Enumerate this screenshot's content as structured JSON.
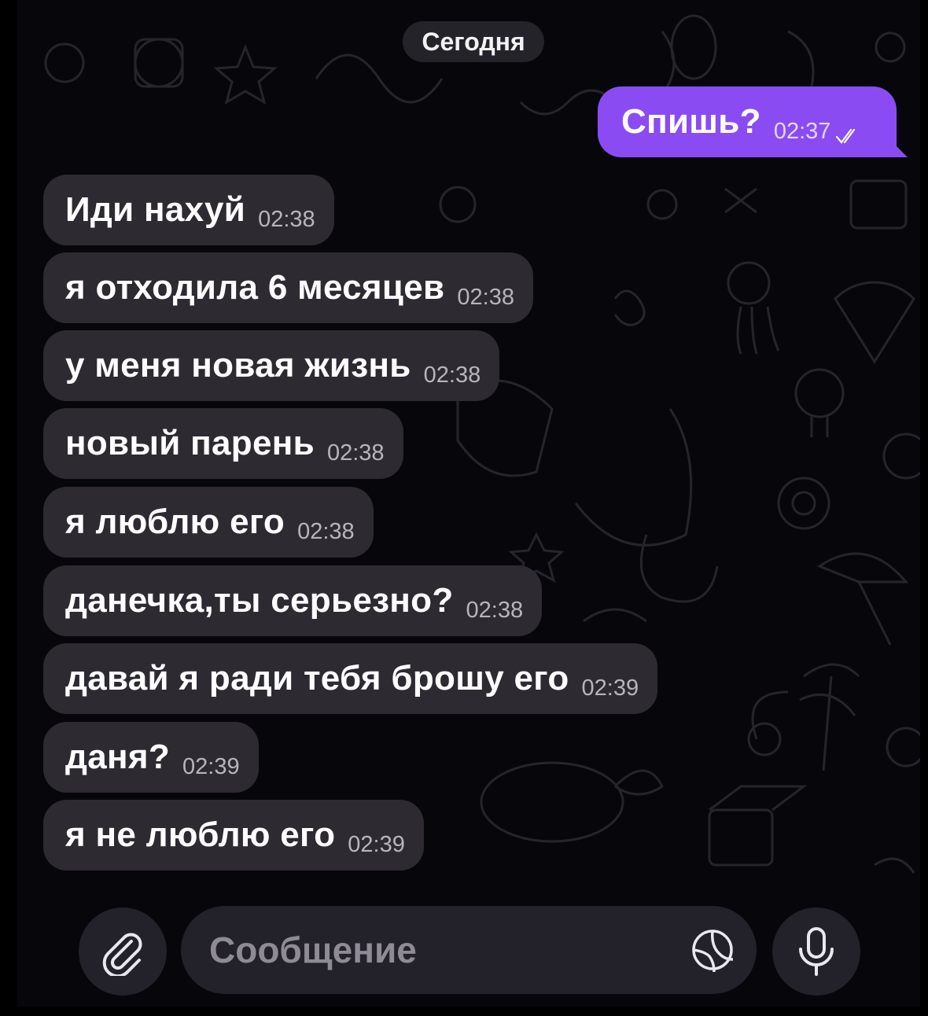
{
  "date_separator": "Сегодня",
  "outgoing": {
    "text": "Спишь?",
    "time": "02:37",
    "status": "read"
  },
  "incoming": [
    {
      "text": "Иди нахуй",
      "time": "02:38"
    },
    {
      "text": "я отходила 6 месяцев",
      "time": "02:38"
    },
    {
      "text": "у меня новая жизнь",
      "time": "02:38"
    },
    {
      "text": "новый парень",
      "time": "02:38"
    },
    {
      "text": "я люблю его",
      "time": "02:38"
    },
    {
      "text": "данечка,ты серьезно?",
      "time": "02:38"
    },
    {
      "text": "давай я ради тебя брошу его",
      "time": "02:39"
    },
    {
      "text": "даня?",
      "time": "02:39"
    },
    {
      "text": "я не люблю его",
      "time": "02:39"
    }
  ],
  "composer": {
    "placeholder": "Сообщение",
    "attach_icon": "paperclip-icon",
    "sticker_icon": "sticker-icon",
    "mic_icon": "microphone-icon"
  },
  "colors": {
    "outgoing_bubble": "#8a4cf2",
    "incoming_bubble": "#2d2a32",
    "background": "#07070b"
  }
}
